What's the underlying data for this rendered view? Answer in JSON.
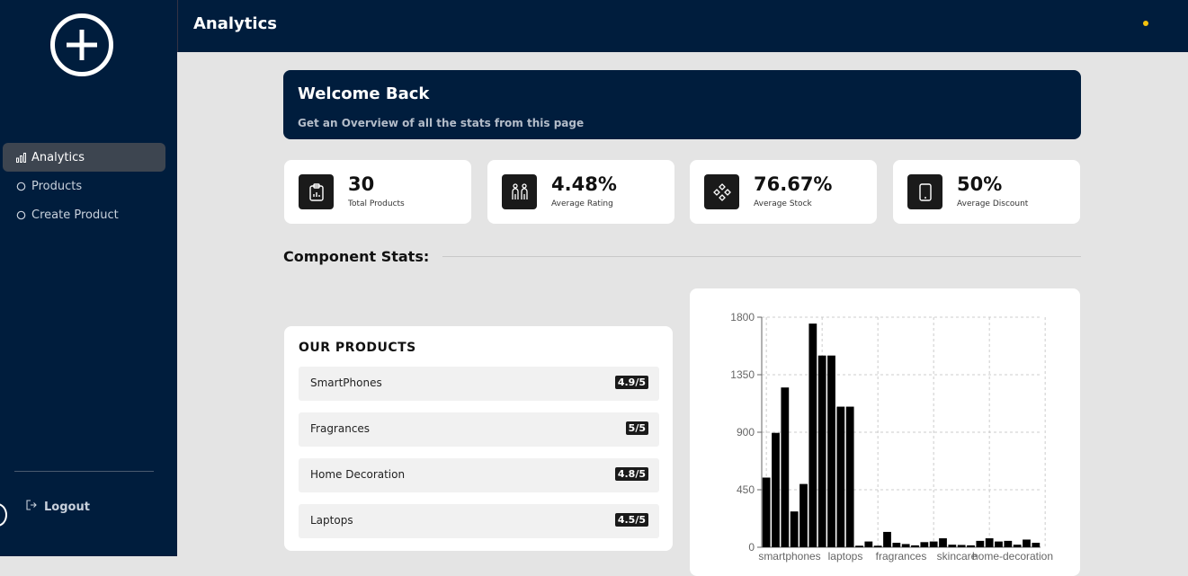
{
  "sidebar": {
    "items": [
      {
        "label": "Analytics",
        "icon": "bar-chart-icon"
      },
      {
        "label": "Products",
        "icon": "circle-icon"
      },
      {
        "label": "Create Product",
        "icon": "circle-icon"
      }
    ],
    "logout_label": "Logout"
  },
  "header": {
    "title": "Analytics"
  },
  "welcome": {
    "title": "Welcome Back",
    "subtitle": "Get an Overview of all the stats from this page"
  },
  "stats": [
    {
      "value": "30",
      "label": "Total Products",
      "icon": "clipboard-chart-icon"
    },
    {
      "value": "4.48%",
      "label": "Average Rating",
      "icon": "people-icon"
    },
    {
      "value": "76.67%",
      "label": "Average Stock",
      "icon": "diamond-grid-icon"
    },
    {
      "value": "50%",
      "label": "Average Discount",
      "icon": "tablet-icon"
    }
  ],
  "section_title": "Component Stats:",
  "products_panel": {
    "title": "OUR PRODUCTS",
    "items": [
      {
        "name": "SmartPhones",
        "rating": "4.9/5"
      },
      {
        "name": "Fragrances",
        "rating": "5/5"
      },
      {
        "name": "Home Decoration",
        "rating": "4.8/5"
      },
      {
        "name": "Laptops",
        "rating": "4.5/5"
      }
    ]
  },
  "chart_data": {
    "type": "bar",
    "categories": [
      "smartphones",
      "laptops",
      "fragrances",
      "skincare",
      "home-decoration"
    ],
    "values": [
      545,
      895,
      1250,
      280,
      495,
      1750,
      1500,
      1500,
      1100,
      1100,
      12,
      45,
      12,
      120,
      35,
      25,
      15,
      40,
      45,
      70,
      20,
      18,
      15,
      50,
      70,
      45,
      50,
      20,
      60,
      35
    ],
    "ylim": [
      0,
      1800
    ],
    "yticks": [
      0,
      450,
      900,
      1350,
      1800
    ],
    "grid": true
  }
}
